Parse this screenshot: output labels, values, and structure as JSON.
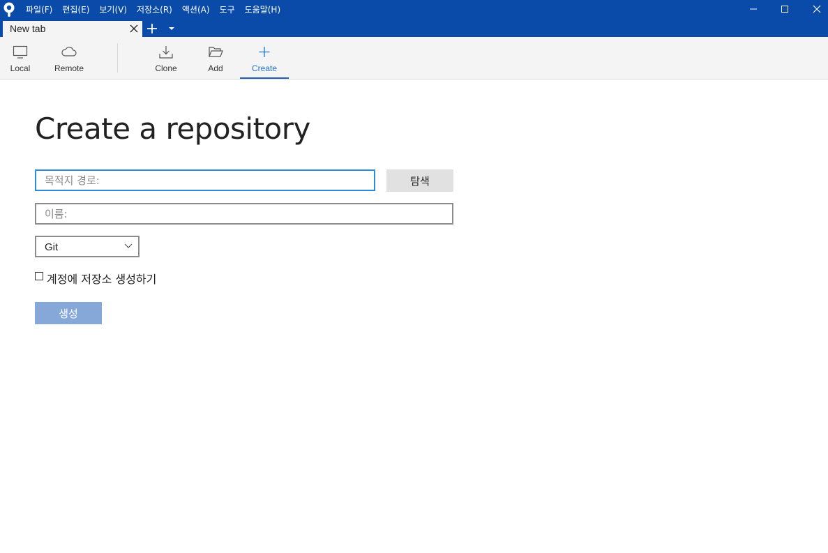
{
  "menu": {
    "items": [
      "파일(F)",
      "편집(E)",
      "보기(V)",
      "저장소(R)",
      "액션(A)",
      "도구",
      "도움말(H)"
    ]
  },
  "window_controls": [
    "minimize-icon",
    "maximize-icon",
    "close-icon"
  ],
  "tabs": [
    {
      "label": "New tab"
    }
  ],
  "toolbar": {
    "local_label": "Local",
    "remote_label": "Remote",
    "clone_label": "Clone",
    "add_label": "Add",
    "create_label": "Create",
    "active": "Create"
  },
  "main": {
    "title": "Create a repository",
    "destination_placeholder": "목적지 경로:",
    "destination_value": "",
    "browse_label": "탐색",
    "name_placeholder": "이름:",
    "name_value": "",
    "vcs_selected": "Git",
    "account_checkbox_label": "계정에 저장소 생성하기",
    "account_checked": false,
    "create_button_label": "생성"
  },
  "colors": {
    "titlebar": "#0a4aa8",
    "accent": "#1f74d0",
    "create_button_disabled": "#86a8d9"
  }
}
